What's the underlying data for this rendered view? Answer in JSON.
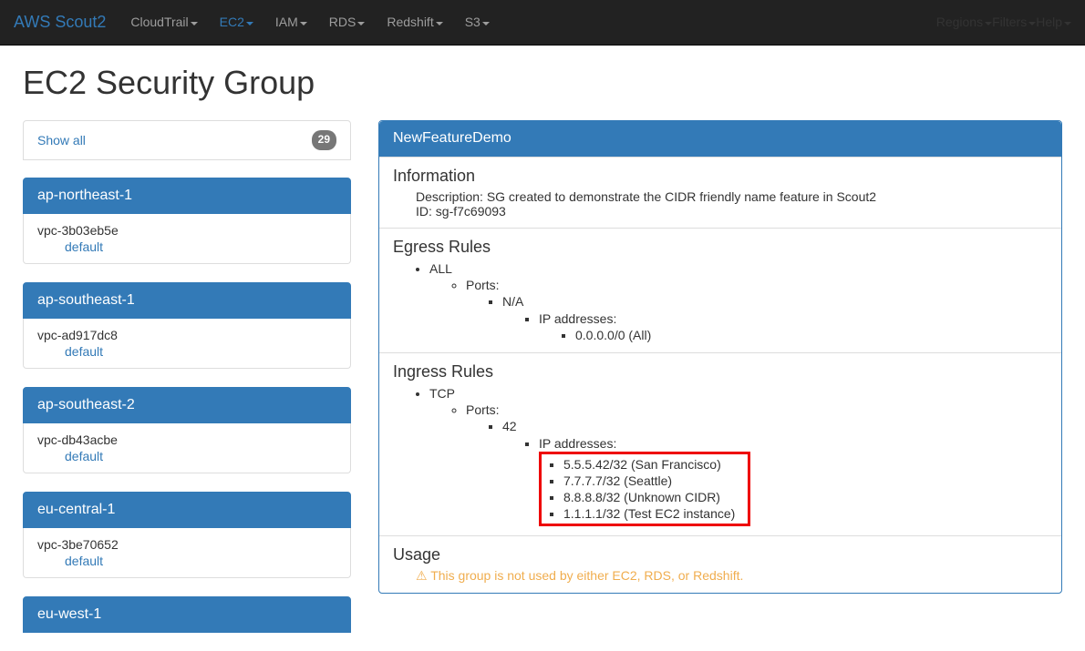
{
  "nav": {
    "brand": "AWS Scout2",
    "left": [
      "CloudTrail",
      "EC2",
      "IAM",
      "RDS",
      "Redshift",
      "S3"
    ],
    "active_index": 1,
    "right": [
      "Regions",
      "Filters",
      "Help"
    ]
  },
  "page": {
    "title": "EC2 Security Group",
    "show_all_label": "Show all",
    "show_all_count": "29"
  },
  "regions": [
    {
      "name": "ap-northeast-1",
      "vpc": "vpc-3b03eb5e",
      "sg": "default"
    },
    {
      "name": "ap-southeast-1",
      "vpc": "vpc-ad917dc8",
      "sg": "default"
    },
    {
      "name": "ap-southeast-2",
      "vpc": "vpc-db43acbe",
      "sg": "default"
    },
    {
      "name": "eu-central-1",
      "vpc": "vpc-3be70652",
      "sg": "default"
    },
    {
      "name": "eu-west-1",
      "vpc": "",
      "sg": ""
    }
  ],
  "detail": {
    "title": "NewFeatureDemo",
    "info_heading": "Information",
    "description_label": "Description: ",
    "description": "SG created to demonstrate the CIDR friendly name feature in Scout2",
    "id_label": "ID: ",
    "id": "sg-f7c69093",
    "egress_heading": "Egress Rules",
    "egress": {
      "proto": "ALL",
      "ports_label": "Ports:",
      "port": "N/A",
      "ip_label": "IP addresses:",
      "ips": [
        "0.0.0.0/0 (All)"
      ]
    },
    "ingress_heading": "Ingress Rules",
    "ingress": {
      "proto": "TCP",
      "ports_label": "Ports:",
      "port": "42",
      "ip_label": "IP addresses:",
      "ips": [
        "5.5.5.42/32 (San Francisco)",
        "7.7.7.7/32 (Seattle)",
        "8.8.8.8/32 (Unknown CIDR)",
        "1.1.1.1/32 (Test EC2 instance)"
      ]
    },
    "usage_heading": "Usage",
    "usage_text": "This group is not used by either EC2, RDS, or Redshift."
  }
}
